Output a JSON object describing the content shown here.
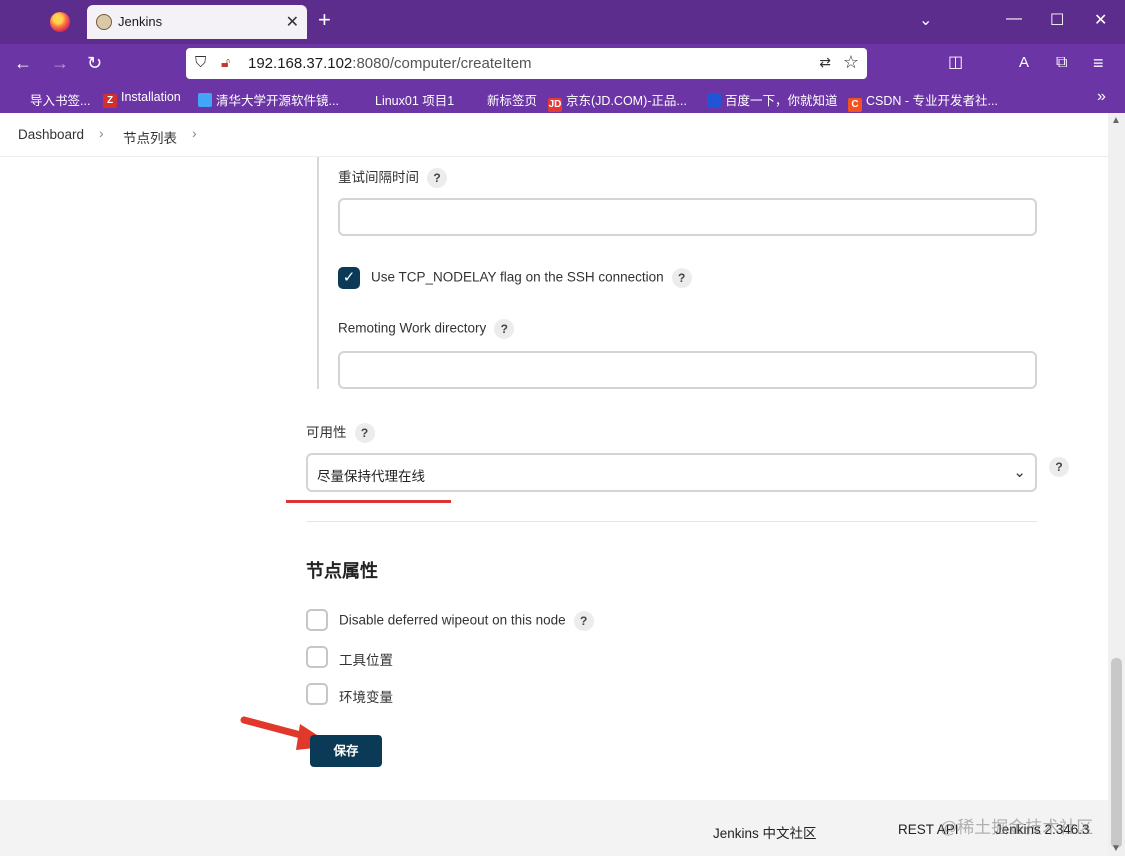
{
  "browser": {
    "tab_title": "Jenkins",
    "url_host": "192.168.37.102",
    "url_rest": ":8080/computer/createItem",
    "bookmarks": [
      {
        "label": "导入书签...",
        "icon_color": "#6c35a6"
      },
      {
        "label": "Installation",
        "icon_color": "#d32f2f"
      },
      {
        "label": "清华大学开源软件镜...",
        "icon_color": "#42a5f5"
      },
      {
        "label": "Linux01 项目1",
        "icon_color": "#6c35a6"
      },
      {
        "label": "新标签页",
        "icon_color": "#6c35a6"
      },
      {
        "label": "京东(JD.COM)-正品...",
        "icon_color": "#e53935"
      },
      {
        "label": "百度一下，你就知道",
        "icon_color": "#1e56d6"
      },
      {
        "label": "CSDN - 专业开发者社...",
        "icon_color": "#f4511e"
      }
    ],
    "bookmark_icon_letters": [
      "",
      "Z",
      "",
      "",
      "",
      "JD",
      "",
      "C"
    ]
  },
  "breadcrumb": {
    "items": [
      "Dashboard",
      "节点列表"
    ]
  },
  "form": {
    "retry_interval_label": "重试间隔时间",
    "retry_interval_value": "",
    "tcp_nodelay_label": "Use TCP_NODELAY flag on the SSH connection",
    "tcp_nodelay_checked": true,
    "remoting_dir_label": "Remoting Work directory",
    "remoting_dir_value": "",
    "availability_label": "可用性",
    "availability_value": "尽量保持代理在线",
    "node_properties_title": "节点属性",
    "properties": [
      {
        "label": "Disable deferred wipeout on this node",
        "checked": false,
        "has_help": true
      },
      {
        "label": "工具位置",
        "checked": false,
        "has_help": false
      },
      {
        "label": "环境变量",
        "checked": false,
        "has_help": false
      }
    ],
    "save_label": "保存",
    "help_glyph": "?"
  },
  "footer": {
    "community": "Jenkins 中文社区",
    "rest_api": "REST API",
    "version": "Jenkins 2.346.3"
  },
  "watermark": "@稀土掘金技术社区",
  "colors": {
    "accent": "#0b3a57",
    "chrome": "#6c35a6",
    "highlight": "#d33333"
  }
}
